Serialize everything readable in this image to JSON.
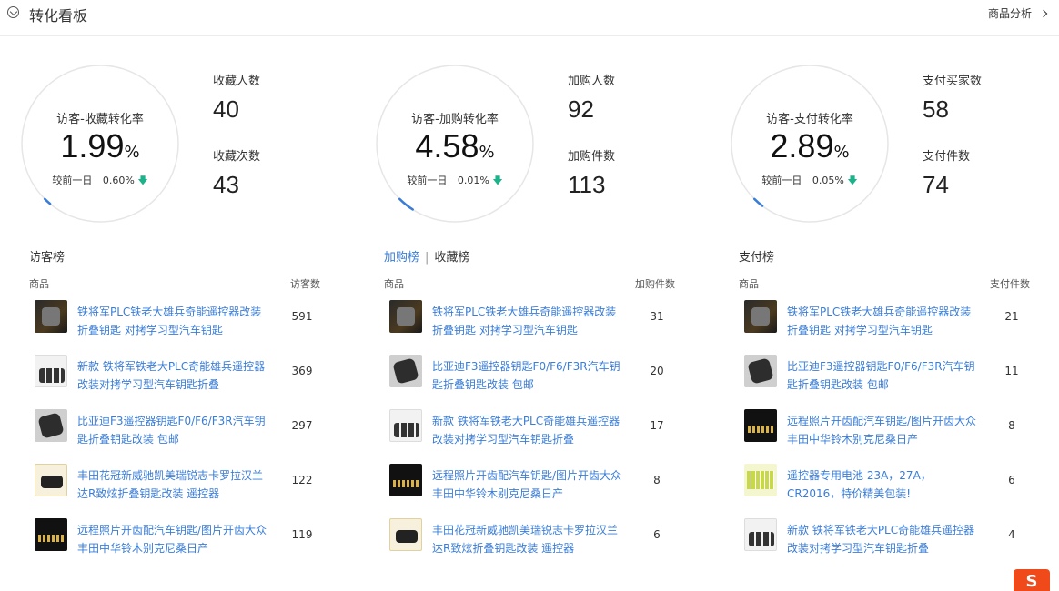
{
  "header": {
    "title": "转化看板",
    "right_link": "商品分析"
  },
  "colors": {
    "accent": "#3a7dd6",
    "down": "#1cb38a",
    "gauge_track": "#e6e6e6"
  },
  "metrics": [
    {
      "gauge": {
        "label": "访客-收藏转化率",
        "value": "1.99",
        "unit": "%",
        "compare_label": "较前一日",
        "compare_value": "0.60%",
        "trend": "down",
        "fill_fraction": 0.02
      },
      "stats": [
        {
          "label": "收藏人数",
          "value": "40"
        },
        {
          "label": "收藏次数",
          "value": "43"
        }
      ]
    },
    {
      "gauge": {
        "label": "访客-加购转化率",
        "value": "4.58",
        "unit": "%",
        "compare_label": "较前一日",
        "compare_value": "0.01%",
        "trend": "down",
        "fill_fraction": 0.046
      },
      "stats": [
        {
          "label": "加购人数",
          "value": "92"
        },
        {
          "label": "加购件数",
          "value": "113"
        }
      ]
    },
    {
      "gauge": {
        "label": "访客-支付转化率",
        "value": "2.89",
        "unit": "%",
        "compare_label": "较前一日",
        "compare_value": "0.05%",
        "trend": "down",
        "fill_fraction": 0.029
      },
      "stats": [
        {
          "label": "支付买家数",
          "value": "58"
        },
        {
          "label": "支付件数",
          "value": "74"
        }
      ]
    }
  ],
  "rankings": [
    {
      "title": "访客榜",
      "col_product": "商品",
      "col_value": "访客数",
      "rows": [
        {
          "name": "铁将军PLC铁老大雄兵奇能遥控器改装折叠钥匙 对拷学习型汽车钥匙",
          "value": "591",
          "thumb": "dark"
        },
        {
          "name": "新款 铁将军铁老大PLC奇能雄兵遥控器改装对拷学习型汽车钥匙折叠",
          "value": "369",
          "thumb": "keys"
        },
        {
          "name": "比亚迪F3遥控器钥匙F0/F6/F3R汽车钥匙折叠钥匙改装 包邮",
          "value": "297",
          "thumb": "byd"
        },
        {
          "name": "丰田花冠新威驰凯美瑞锐志卡罗拉汉兰达R致炫折叠钥匙改装 遥控器",
          "value": "122",
          "thumb": "toyota"
        },
        {
          "name": "远程照片开齿配汽车钥匙/图片开齿大众丰田中华铃木别克尼桑日产",
          "value": "119",
          "thumb": "blackbox"
        }
      ]
    },
    {
      "title": "加购榜",
      "title_alt": "收藏榜",
      "col_product": "商品",
      "col_value": "加购件数",
      "rows": [
        {
          "name": "铁将军PLC铁老大雄兵奇能遥控器改装折叠钥匙 对拷学习型汽车钥匙",
          "value": "31",
          "thumb": "dark"
        },
        {
          "name": "比亚迪F3遥控器钥匙F0/F6/F3R汽车钥匙折叠钥匙改装 包邮",
          "value": "20",
          "thumb": "byd"
        },
        {
          "name": "新款 铁将军铁老大PLC奇能雄兵遥控器改装对拷学习型汽车钥匙折叠",
          "value": "17",
          "thumb": "keys"
        },
        {
          "name": "远程照片开齿配汽车钥匙/图片开齿大众丰田中华铃木别克尼桑日产",
          "value": "8",
          "thumb": "blackbox"
        },
        {
          "name": "丰田花冠新威驰凯美瑞锐志卡罗拉汉兰达R致炫折叠钥匙改装 遥控器",
          "value": "6",
          "thumb": "toyota"
        }
      ]
    },
    {
      "title": "支付榜",
      "col_product": "商品",
      "col_value": "支付件数",
      "rows": [
        {
          "name": "铁将军PLC铁老大雄兵奇能遥控器改装折叠钥匙 对拷学习型汽车钥匙",
          "value": "21",
          "thumb": "dark"
        },
        {
          "name": "比亚迪F3遥控器钥匙F0/F6/F3R汽车钥匙折叠钥匙改装 包邮",
          "value": "11",
          "thumb": "byd"
        },
        {
          "name": "远程照片开齿配汽车钥匙/图片开齿大众丰田中华铃木别克尼桑日产",
          "value": "8",
          "thumb": "blackbox"
        },
        {
          "name": "遥控器专用电池 23A，27A，CR2016，特价精美包装!",
          "value": "6",
          "thumb": "battery"
        },
        {
          "name": "新款 铁将军铁老大PLC奇能雄兵遥控器改装对拷学习型汽车钥匙折叠",
          "value": "4",
          "thumb": "keys"
        }
      ]
    }
  ],
  "floating_badge": {
    "icon": "sogou-ime-icon",
    "glyph": "S"
  }
}
